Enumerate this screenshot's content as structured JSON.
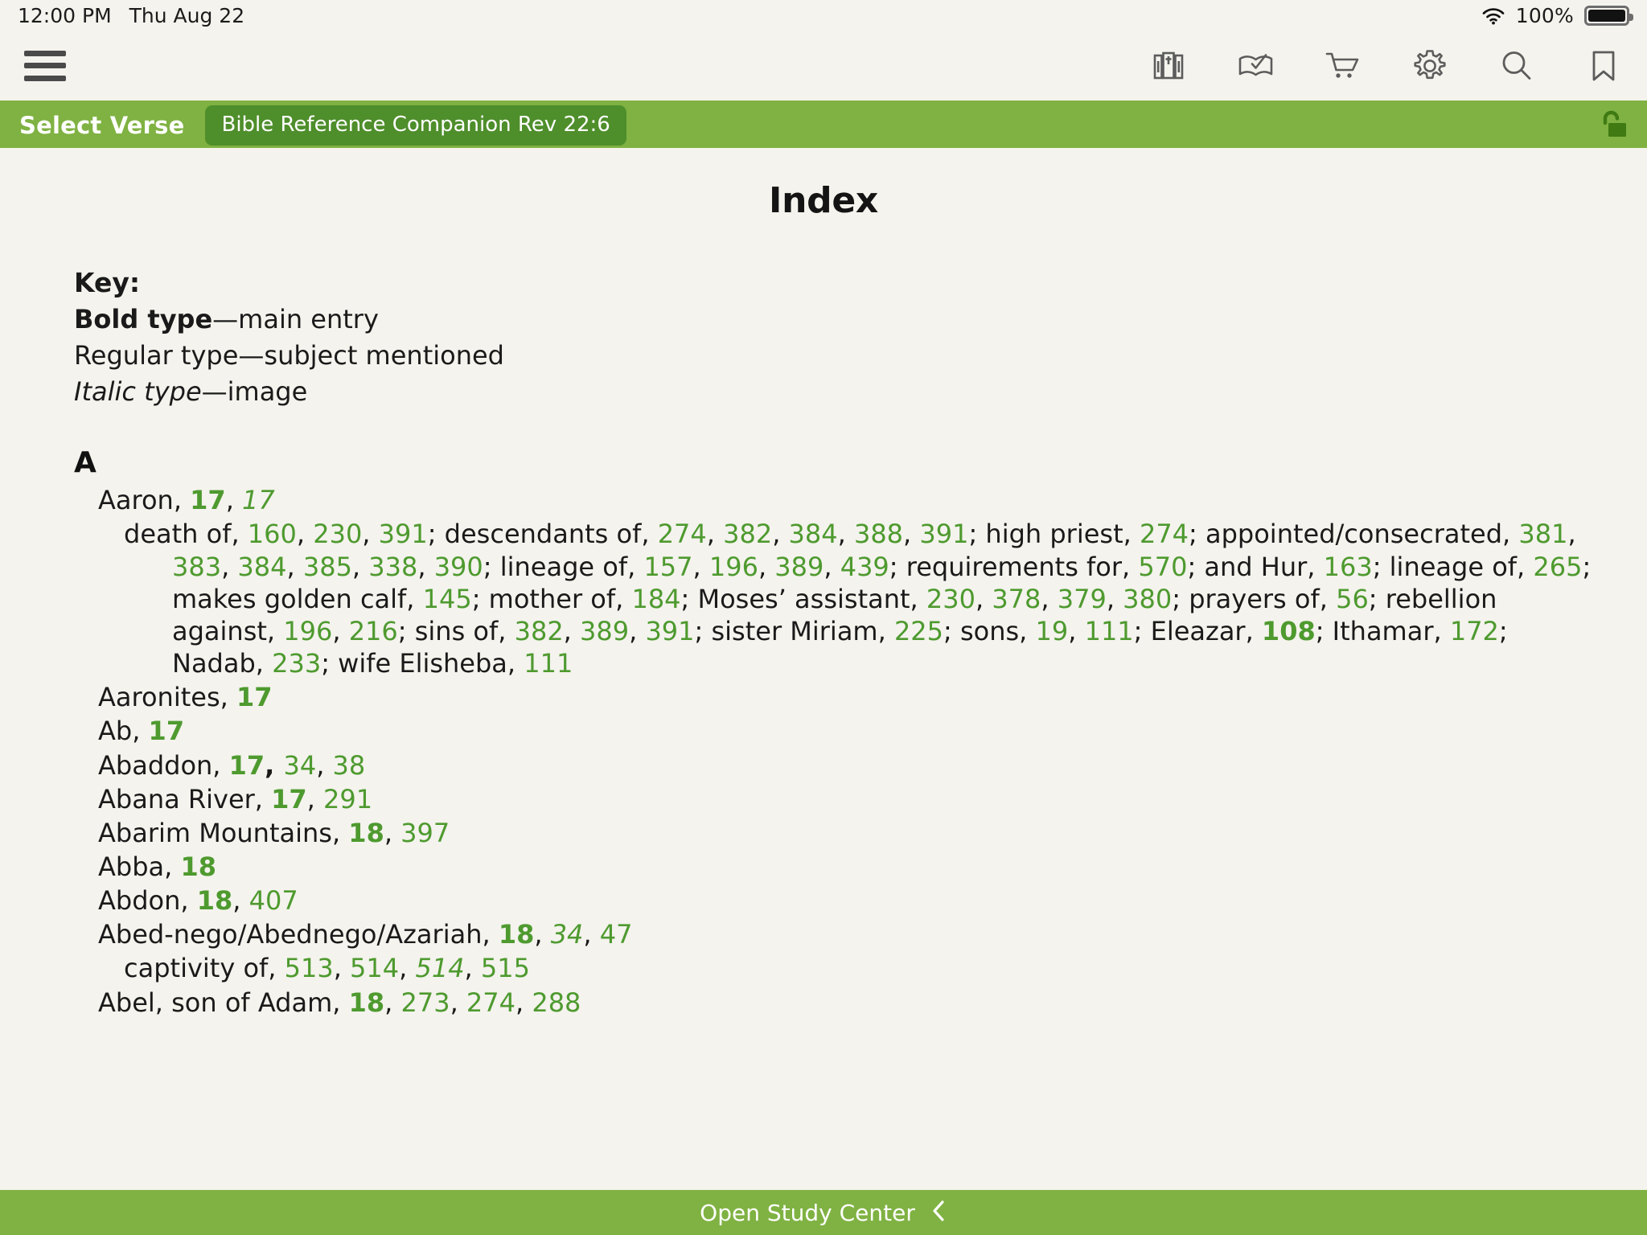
{
  "status_bar": {
    "time": "12:00 PM",
    "date": "Thu Aug 22",
    "wifi_icon": "wifi-icon",
    "battery_percent": "100%",
    "battery_icon": "battery-full-icon"
  },
  "toolbar": {
    "menu_icon": "hamburger-menu-icon",
    "icons": [
      {
        "name": "library-books-icon",
        "label": "Library"
      },
      {
        "name": "reading-plan-book-check-icon",
        "label": "Reading Plan"
      },
      {
        "name": "shopping-cart-icon",
        "label": "Store"
      },
      {
        "name": "gear-icon",
        "label": "Settings"
      },
      {
        "name": "search-icon",
        "label": "Search"
      },
      {
        "name": "bookmark-icon",
        "label": "Bookmarks"
      }
    ]
  },
  "action_bar": {
    "select_verse_label": "Select Verse",
    "reference_pill": "Bible Reference Companion Rev 22:6",
    "lock_icon": "unlocked-padlock-icon",
    "background_color": "#7fb242",
    "pill_color": "#4e8e2b"
  },
  "document": {
    "title": "Index",
    "key": {
      "heading": "Key:",
      "lines": [
        {
          "bold": "Bold type",
          "rest": "—main entry"
        },
        {
          "plain": "Regular type—subject mentioned"
        },
        {
          "italic": "Italic type",
          "rest": "—image"
        }
      ]
    },
    "letter_heading": "A",
    "entries": [
      {
        "type": "main",
        "term": "Aaron,",
        "refs": [
          {
            "text": "17",
            "style": "bold"
          },
          {
            "sep": ", "
          },
          {
            "text": "17",
            "style": "italic"
          }
        ]
      },
      {
        "type": "sub",
        "runs": [
          {
            "t": "death of, ",
            "s": "plain"
          },
          {
            "t": "160",
            "s": "green"
          },
          {
            "t": ", ",
            "s": "plain"
          },
          {
            "t": "230",
            "s": "green"
          },
          {
            "t": ", ",
            "s": "plain"
          },
          {
            "t": "391",
            "s": "green"
          },
          {
            "t": "; descendants of, ",
            "s": "plain"
          },
          {
            "t": "274",
            "s": "green"
          },
          {
            "t": ", ",
            "s": "plain"
          },
          {
            "t": "382",
            "s": "green"
          },
          {
            "t": ", ",
            "s": "plain"
          },
          {
            "t": "384",
            "s": "green"
          },
          {
            "t": ", ",
            "s": "plain"
          },
          {
            "t": "388",
            "s": "green"
          },
          {
            "t": ", ",
            "s": "plain"
          },
          {
            "t": "391",
            "s": "green"
          },
          {
            "t": "; high priest, ",
            "s": "plain"
          },
          {
            "t": "274",
            "s": "green"
          },
          {
            "t": "; appointed/consecrated, ",
            "s": "plain"
          },
          {
            "t": "381",
            "s": "green"
          },
          {
            "t": ", ",
            "s": "plain"
          },
          {
            "t": "383",
            "s": "green"
          },
          {
            "t": ", ",
            "s": "plain"
          },
          {
            "t": "384",
            "s": "green"
          },
          {
            "t": ", ",
            "s": "plain"
          },
          {
            "t": "385",
            "s": "green"
          },
          {
            "t": ", ",
            "s": "plain"
          },
          {
            "t": "338",
            "s": "green"
          },
          {
            "t": ", ",
            "s": "plain"
          },
          {
            "t": "390",
            "s": "green"
          },
          {
            "t": "; lineage of, ",
            "s": "plain"
          },
          {
            "t": "157",
            "s": "green"
          },
          {
            "t": ", ",
            "s": "plain"
          },
          {
            "t": "196",
            "s": "green"
          },
          {
            "t": ", ",
            "s": "plain"
          },
          {
            "t": "389",
            "s": "green"
          },
          {
            "t": ", ",
            "s": "plain"
          },
          {
            "t": "439",
            "s": "green"
          },
          {
            "t": "; requirements for, ",
            "s": "plain"
          },
          {
            "t": "570",
            "s": "green"
          },
          {
            "t": "; and Hur, ",
            "s": "plain"
          },
          {
            "t": "163",
            "s": "green"
          },
          {
            "t": "; lineage of, ",
            "s": "plain"
          },
          {
            "t": "265",
            "s": "green"
          },
          {
            "t": "; makes golden calf, ",
            "s": "plain"
          },
          {
            "t": "145",
            "s": "green"
          },
          {
            "t": "; mother of, ",
            "s": "plain"
          },
          {
            "t": "184",
            "s": "green"
          },
          {
            "t": "; Moses’ assistant, ",
            "s": "plain"
          },
          {
            "t": "230",
            "s": "green"
          },
          {
            "t": ", ",
            "s": "plain"
          },
          {
            "t": "378",
            "s": "green"
          },
          {
            "t": ", ",
            "s": "plain"
          },
          {
            "t": "379",
            "s": "green"
          },
          {
            "t": ", ",
            "s": "plain"
          },
          {
            "t": "380",
            "s": "green"
          },
          {
            "t": "; prayers of, ",
            "s": "plain"
          },
          {
            "t": "56",
            "s": "green"
          },
          {
            "t": "; rebellion against, ",
            "s": "plain"
          },
          {
            "t": "196",
            "s": "green"
          },
          {
            "t": ", ",
            "s": "plain"
          },
          {
            "t": "216",
            "s": "green"
          },
          {
            "t": "; sins of, ",
            "s": "plain"
          },
          {
            "t": "382",
            "s": "green"
          },
          {
            "t": ", ",
            "s": "plain"
          },
          {
            "t": "389",
            "s": "green"
          },
          {
            "t": ", ",
            "s": "plain"
          },
          {
            "t": "391",
            "s": "green"
          },
          {
            "t": "; sister Miriam, ",
            "s": "plain"
          },
          {
            "t": "225",
            "s": "green"
          },
          {
            "t": "; sons, ",
            "s": "plain"
          },
          {
            "t": "19",
            "s": "green"
          },
          {
            "t": ", ",
            "s": "plain"
          },
          {
            "t": "111",
            "s": "green"
          },
          {
            "t": "; Eleazar, ",
            "s": "plain"
          },
          {
            "t": "108",
            "s": "green-bold"
          },
          {
            "t": "; Ithamar, ",
            "s": "plain"
          },
          {
            "t": "172",
            "s": "green"
          },
          {
            "t": "; Nadab, ",
            "s": "plain"
          },
          {
            "t": "233",
            "s": "green"
          },
          {
            "t": "; wife Elisheba, ",
            "s": "plain"
          },
          {
            "t": "111",
            "s": "green"
          }
        ]
      },
      {
        "type": "main",
        "runs": [
          {
            "t": "Aaronites, ",
            "s": "plain"
          },
          {
            "t": "17",
            "s": "green-bold"
          }
        ]
      },
      {
        "type": "main",
        "runs": [
          {
            "t": "Ab, ",
            "s": "plain"
          },
          {
            "t": "17",
            "s": "green-bold"
          }
        ]
      },
      {
        "type": "main",
        "runs": [
          {
            "t": "Abaddon, ",
            "s": "plain"
          },
          {
            "t": "17",
            "s": "green-bold"
          },
          {
            "t": ", ",
            "s": "bold"
          },
          {
            "t": "34",
            "s": "green"
          },
          {
            "t": ", ",
            "s": "plain"
          },
          {
            "t": "38",
            "s": "green"
          }
        ]
      },
      {
        "type": "main",
        "runs": [
          {
            "t": "Abana River, ",
            "s": "plain"
          },
          {
            "t": "17",
            "s": "green-bold"
          },
          {
            "t": ", ",
            "s": "plain"
          },
          {
            "t": "291",
            "s": "green"
          }
        ]
      },
      {
        "type": "main",
        "runs": [
          {
            "t": "Abarim Mountains, ",
            "s": "plain"
          },
          {
            "t": "18",
            "s": "green-bold"
          },
          {
            "t": ", ",
            "s": "plain"
          },
          {
            "t": "397",
            "s": "green"
          }
        ]
      },
      {
        "type": "main",
        "runs": [
          {
            "t": "Abba, ",
            "s": "plain"
          },
          {
            "t": "18",
            "s": "green-bold"
          }
        ]
      },
      {
        "type": "main",
        "runs": [
          {
            "t": "Abdon, ",
            "s": "plain"
          },
          {
            "t": "18",
            "s": "green-bold"
          },
          {
            "t": ", ",
            "s": "plain"
          },
          {
            "t": "407",
            "s": "green"
          }
        ]
      },
      {
        "type": "main",
        "runs": [
          {
            "t": "Abed-nego/Abednego/Azariah, ",
            "s": "plain"
          },
          {
            "t": "18",
            "s": "green-bold"
          },
          {
            "t": ", ",
            "s": "plain"
          },
          {
            "t": "34",
            "s": "green-italic"
          },
          {
            "t": ", ",
            "s": "plain"
          },
          {
            "t": "47",
            "s": "green"
          }
        ]
      },
      {
        "type": "sub2",
        "runs": [
          {
            "t": "captivity of, ",
            "s": "plain"
          },
          {
            "t": "513",
            "s": "green"
          },
          {
            "t": ", ",
            "s": "plain"
          },
          {
            "t": "514",
            "s": "green"
          },
          {
            "t": ", ",
            "s": "plain"
          },
          {
            "t": "514",
            "s": "green-italic"
          },
          {
            "t": ", ",
            "s": "plain"
          },
          {
            "t": "515",
            "s": "green"
          }
        ]
      },
      {
        "type": "main",
        "runs": [
          {
            "t": "Abel, son of Adam, ",
            "s": "plain"
          },
          {
            "t": "18",
            "s": "green-bold"
          },
          {
            "t": ", ",
            "s": "plain"
          },
          {
            "t": "273",
            "s": "green"
          },
          {
            "t": ", ",
            "s": "plain"
          },
          {
            "t": "274",
            "s": "green"
          },
          {
            "t": ", ",
            "s": "plain"
          },
          {
            "t": "288",
            "s": "green"
          }
        ]
      }
    ]
  },
  "bottom_bar": {
    "label": "Open Study Center",
    "chevron_icon": "chevron-left-icon",
    "background_color": "#7fb242"
  },
  "colors": {
    "page_background": "#f4f3ed",
    "green_accent": "#7fb242",
    "link_green": "#4e9a2f",
    "text": "#1a1a1a"
  }
}
